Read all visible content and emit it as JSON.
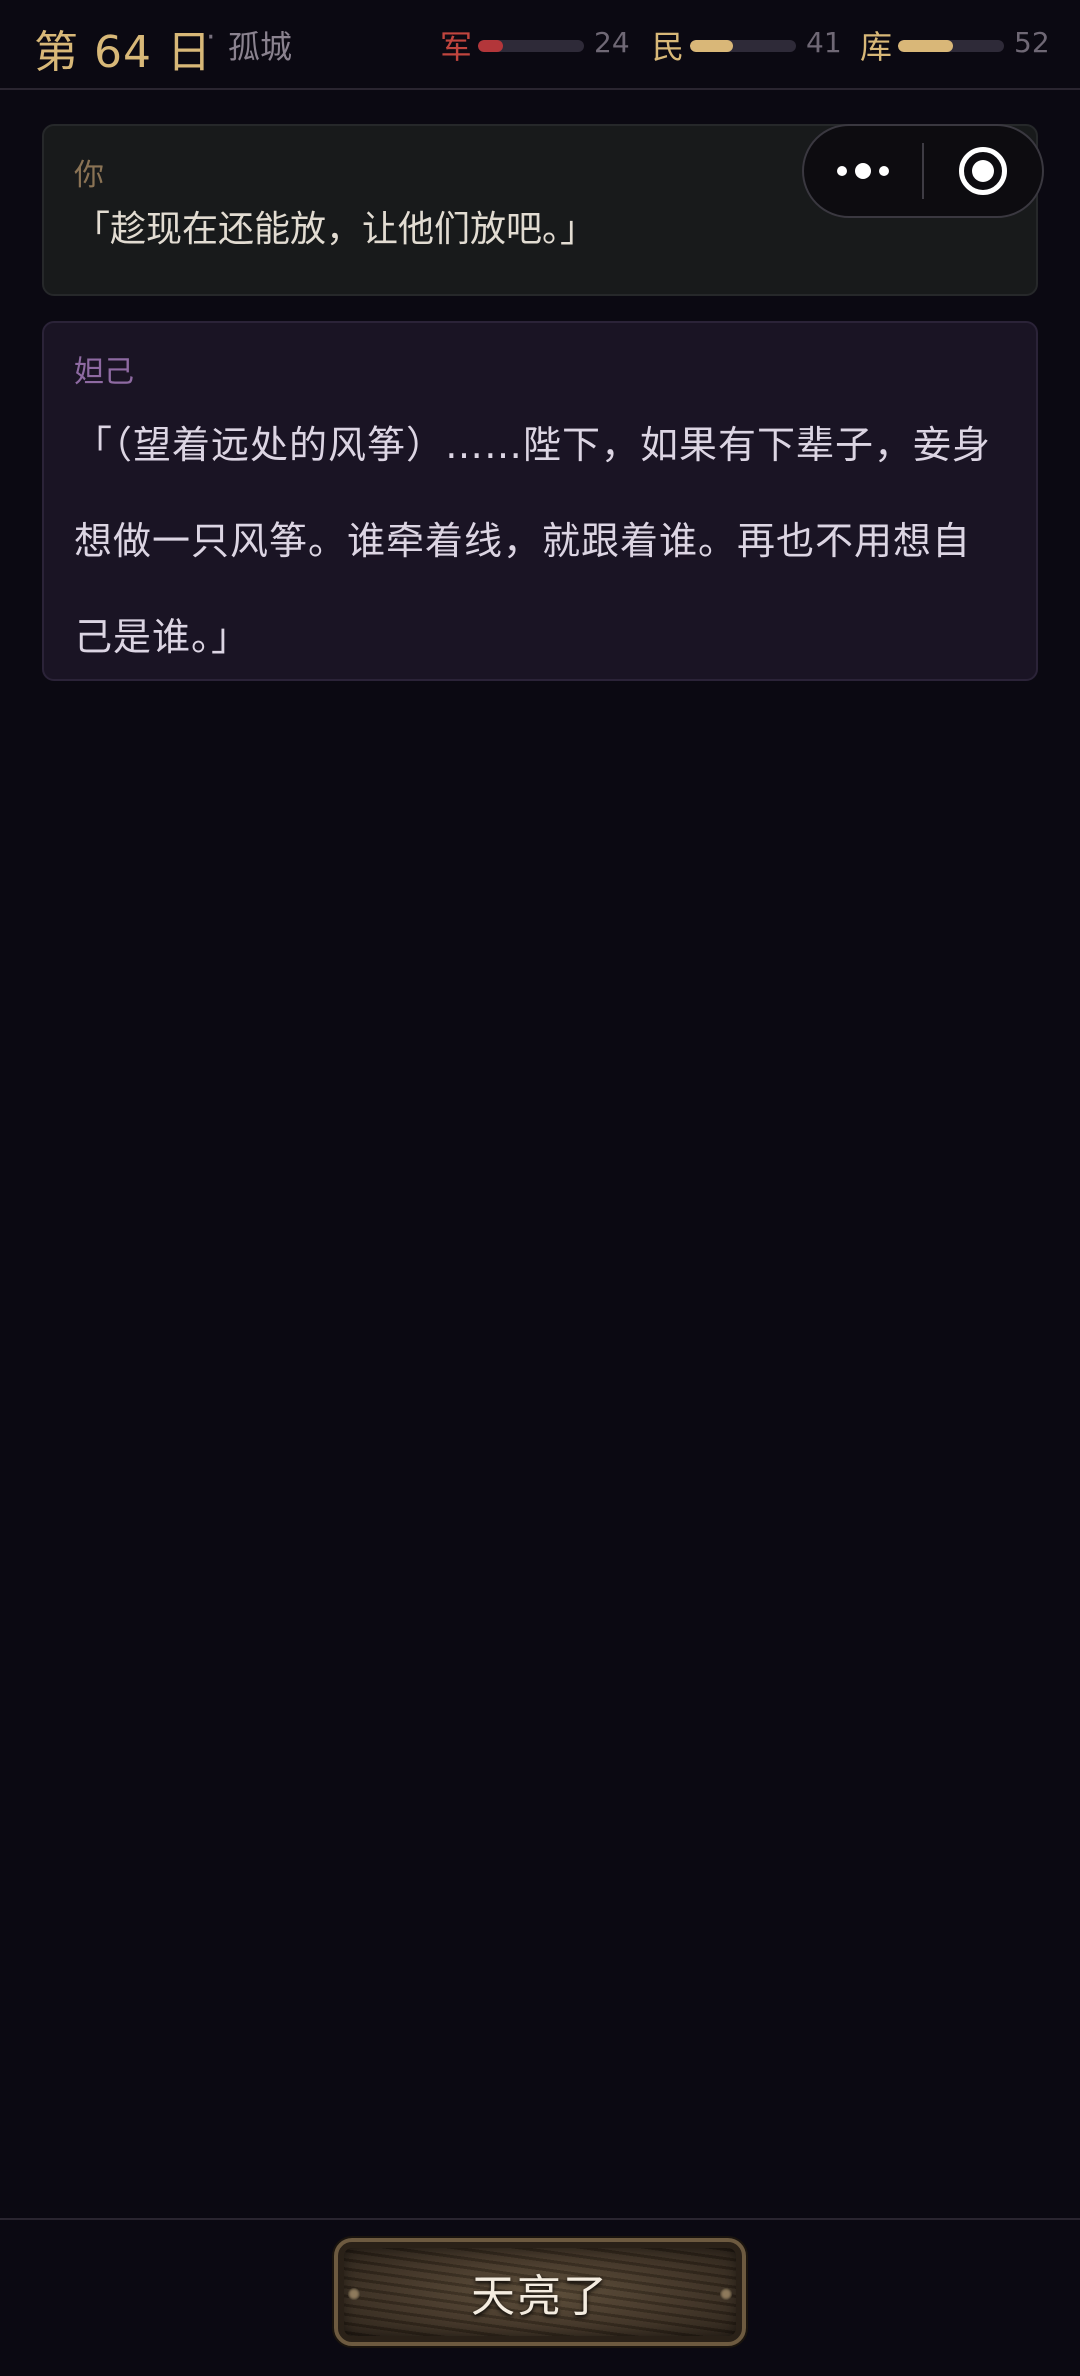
{
  "header": {
    "day_label": "第 64 日",
    "separator": "·",
    "location": "孤城",
    "stats": [
      {
        "label": "军",
        "value": "24",
        "fill": 0.24,
        "color": "#b3363a"
      },
      {
        "label": "民",
        "value": "41",
        "fill": 0.41,
        "color": "#d9b778"
      },
      {
        "label": "库",
        "value": "52",
        "fill": 0.52,
        "color": "#d9b778"
      }
    ]
  },
  "capsule": {
    "more_icon": "more-dots-icon",
    "close_icon": "target-circle-icon"
  },
  "dialogue": [
    {
      "speaker": "你",
      "text": "「趁现在还能放，让他们放吧。」"
    },
    {
      "speaker": "妲己",
      "text": "「（望着远处的风筝）……陛下，如果有下辈子，妾身想做一只风筝。谁牵着线，就跟着谁。再也不用想自己是谁。」"
    }
  ],
  "action": {
    "label": "天亮了"
  }
}
